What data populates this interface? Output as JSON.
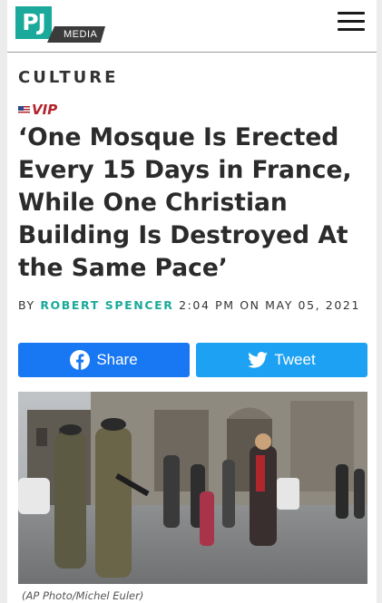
{
  "header": {
    "logo_text": "PJ",
    "logo_sub": "MEDIA",
    "menu_icon": "hamburger-menu-icon"
  },
  "article": {
    "category": "CULTURE",
    "badge": "VIP",
    "title": "‘One Mosque Is Erected Every 15 Days in France, While One Christian Building Is Destroyed At the Same Pace’",
    "byline_prefix": "BY",
    "author": "ROBERT SPENCER",
    "timestamp": "2:04 PM ON MAY 05, 2021",
    "caption": "(AP Photo/Michel Euler)"
  },
  "share": {
    "facebook_label": "Share",
    "twitter_label": "Tweet",
    "facebook_color": "#1877f2",
    "twitter_color": "#1da1f2"
  },
  "colors": {
    "brand": "#1aa99a",
    "vip": "#b3232c"
  }
}
